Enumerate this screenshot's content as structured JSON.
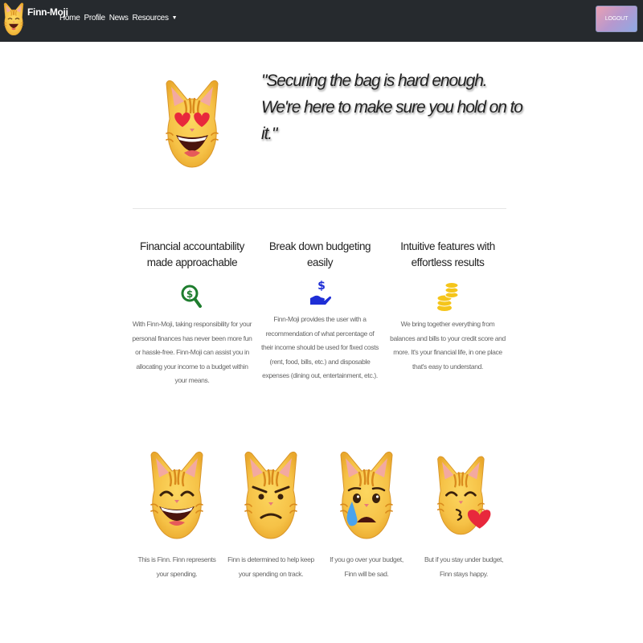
{
  "navbar": {
    "brand": "Finn-Moji",
    "links": [
      "Home",
      "Profile",
      "News",
      "Resources"
    ],
    "resources_caret": "▼",
    "logout": "LOGOUT"
  },
  "hero": {
    "emoji": "heart-eyes-cat-icon",
    "quote": "\"Securing the bag is hard enough. We're here to make sure you hold on to it.\""
  },
  "features": [
    {
      "title": "Financial accountability made approachable",
      "icon": "money-magnifier-icon",
      "description": "With Finn-Moji, taking responsibility for your personal finances has never been more fun or hassle-free. Finn-Moji can assist you in allocating your income to a budget within your means."
    },
    {
      "title": "Break down budgeting easily",
      "icon": "hand-holding-money-icon",
      "description": "Finn-Moji provides the user with a recommendation of what percentage of their income should be used for fixed costs (rent, food, bills, etc.) and disposable expenses (dining out, entertainment, etc.)."
    },
    {
      "title": "Intuitive features with effortless results",
      "icon": "coin-stack-icon",
      "description": "We bring together everything from balances and bills to your credit score and more. It's your financial life, in one place that's easy to understand."
    }
  ],
  "cats": [
    {
      "emoji": "grinning-cat-icon",
      "caption": "This is Finn. Finn represents your spending."
    },
    {
      "emoji": "determined-cat-icon",
      "caption": "Finn is determined to help keep your spending on track."
    },
    {
      "emoji": "crying-cat-icon",
      "caption": "If you go over your budget, Finn will be sad."
    },
    {
      "emoji": "kissing-cat-icon",
      "caption": "But if you stay under budget, Finn stays happy."
    }
  ],
  "colors": {
    "navbar_bg": "#262a2e",
    "cat_fur": "#f6c247",
    "cat_stripe": "#d98a1c",
    "money_green": "#1e7d2e",
    "hand_blue": "#1e2ed6",
    "coin_gold": "#f5c51a",
    "heart_red": "#e8283c"
  }
}
